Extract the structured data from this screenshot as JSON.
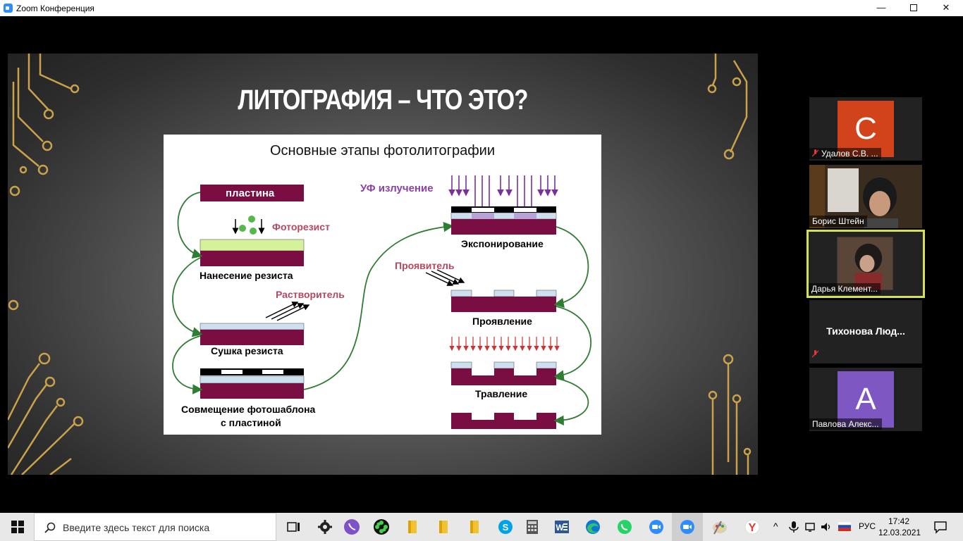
{
  "window": {
    "title": "Zoom Конференция"
  },
  "slide": {
    "title": "ЛИТОГРАФИЯ – ЧТО ЭТО?",
    "diagram_title": "Основные этапы фотолитографии",
    "labels": {
      "plate": "пластина",
      "photoresist": "Фоторезист",
      "resist_apply": "Нанесение резиста",
      "solvent": "Растворитель",
      "resist_dry": "Сушка резиста",
      "mask_align_1": "Совмещение фотошаблона",
      "mask_align_2": "с пластиной",
      "uv": "УФ излучение",
      "exposure": "Экспонирование",
      "developer": "Проявитель",
      "development": "Проявление",
      "etching": "Травление"
    }
  },
  "participants": [
    {
      "initial": "С",
      "name": "Удалов С.В. ...",
      "muted": true,
      "color": "#d2421b"
    },
    {
      "name": "Борис Штейн",
      "muted": false,
      "video": true
    },
    {
      "name": "Дарья Клемент...",
      "muted": false,
      "video": true,
      "active": true
    },
    {
      "name": "Тихонова  Люд...",
      "muted": true
    },
    {
      "initial": "А",
      "name": "Павлова Алекс...",
      "muted": false,
      "color": "#7e57c2"
    }
  ],
  "taskbar": {
    "search_placeholder": "Введите здесь текст для поиска",
    "language": "РУС",
    "time": "17:42",
    "date": "12.03.2021"
  }
}
